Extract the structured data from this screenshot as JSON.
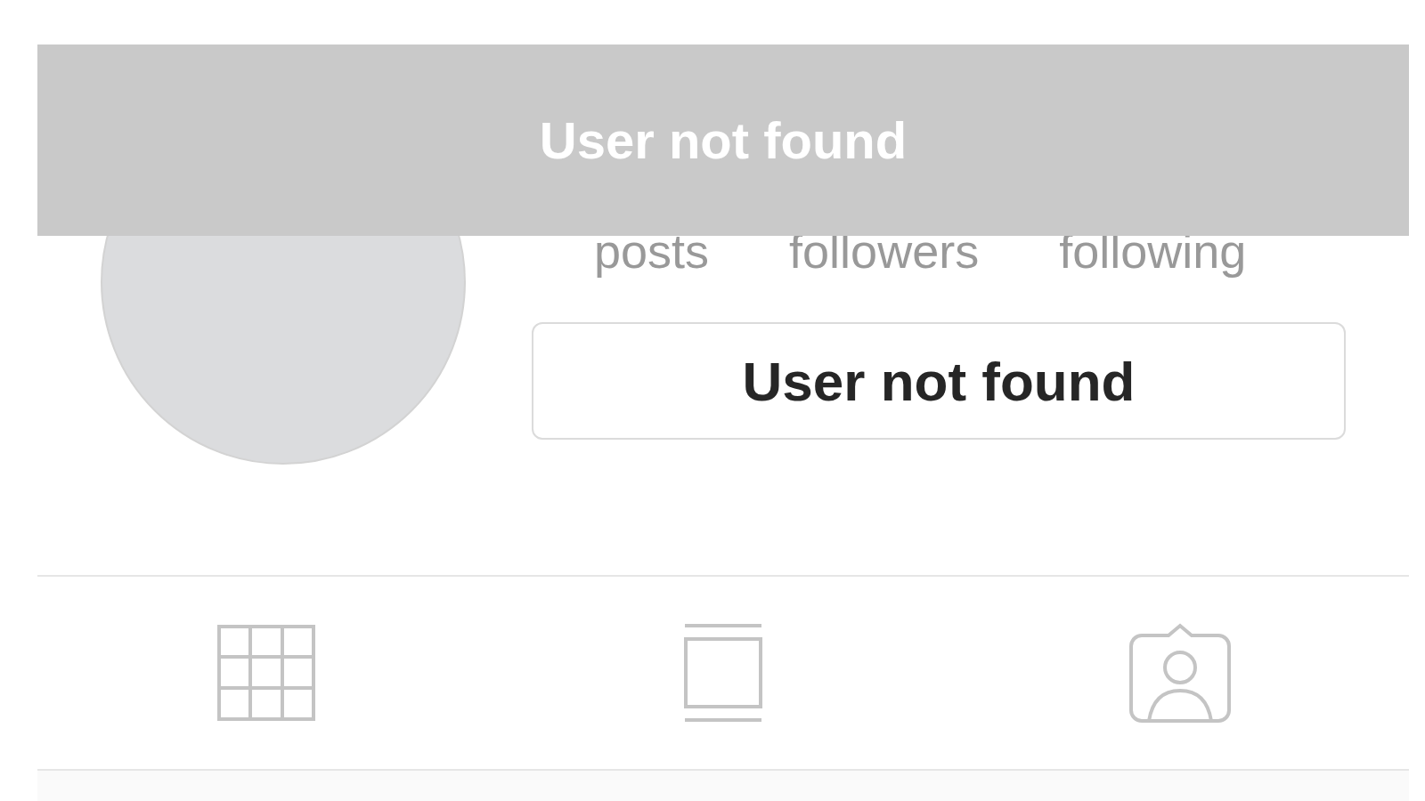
{
  "banner": {
    "text": "User not found"
  },
  "profile": {
    "stats": [
      {
        "label": "posts"
      },
      {
        "label": "followers"
      },
      {
        "label": "following"
      }
    ],
    "button": {
      "label": "User not found"
    }
  },
  "tabs": [
    {
      "kind": "grid"
    },
    {
      "kind": "feed"
    },
    {
      "kind": "tagged"
    }
  ]
}
